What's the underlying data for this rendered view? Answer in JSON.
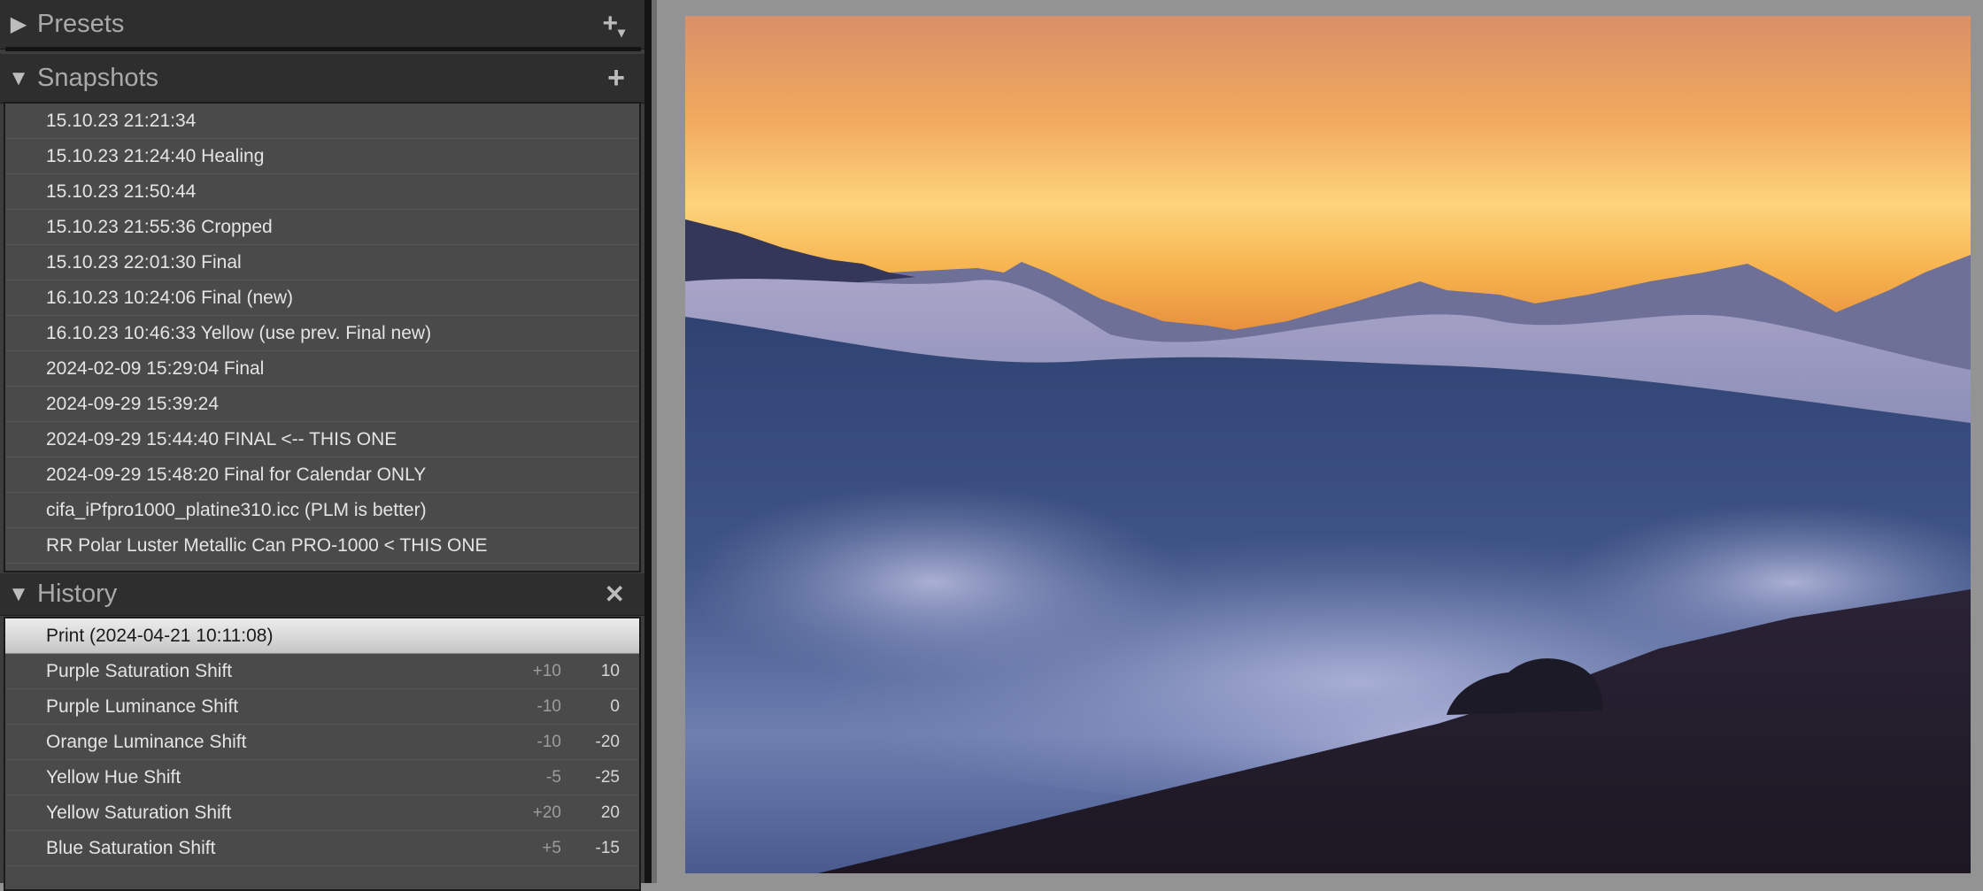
{
  "presets": {
    "title": "Presets",
    "add_icon": "plus-with-dropdown-icon",
    "expand_icon": "collapsed-triangle-icon"
  },
  "snapshots": {
    "title": "Snapshots",
    "add_icon": "plus-icon",
    "expand_icon": "expanded-triangle-icon",
    "items": [
      "15.10.23 21:21:34",
      "15.10.23 21:24:40 Healing",
      "15.10.23 21:50:44",
      "15.10.23 21:55:36 Cropped",
      "15.10.23 22:01:30 Final",
      "16.10.23 10:24:06 Final (new)",
      "16.10.23 10:46:33 Yellow (use prev. Final new)",
      "2024-02-09 15:29:04 Final",
      "2024-09-29 15:39:24",
      "2024-09-29 15:44:40 FINAL <-- THIS ONE",
      "2024-09-29 15:48:20 Final for Calendar ONLY",
      "cifa_iPfpro1000_platine310.icc (PLM is better)",
      "RR Polar Luster Metallic Can PRO-1000 < THIS ONE"
    ]
  },
  "history": {
    "title": "History",
    "clear_icon": "close-icon",
    "expand_icon": "expanded-triangle-icon",
    "items": [
      {
        "label": "Print (2024-04-21 10:11:08)",
        "delta": "",
        "value": "",
        "selected": true
      },
      {
        "label": "Purple Saturation Shift",
        "delta": "+10",
        "value": "10"
      },
      {
        "label": "Purple Luminance Shift",
        "delta": "-10",
        "value": "0"
      },
      {
        "label": "Orange Luminance Shift",
        "delta": "-10",
        "value": "-20"
      },
      {
        "label": "Yellow Hue Shift",
        "delta": "-5",
        "value": "-25"
      },
      {
        "label": "Yellow Saturation Shift",
        "delta": "+20",
        "value": "20"
      },
      {
        "label": "Blue Saturation Shift",
        "delta": "+5",
        "value": "-15"
      }
    ]
  },
  "colors": {
    "panel_bg": "#3d3d3d",
    "list_bg": "#4a4a4a",
    "selected_row": "#dcdcdc",
    "canvas_bg": "#939393"
  }
}
